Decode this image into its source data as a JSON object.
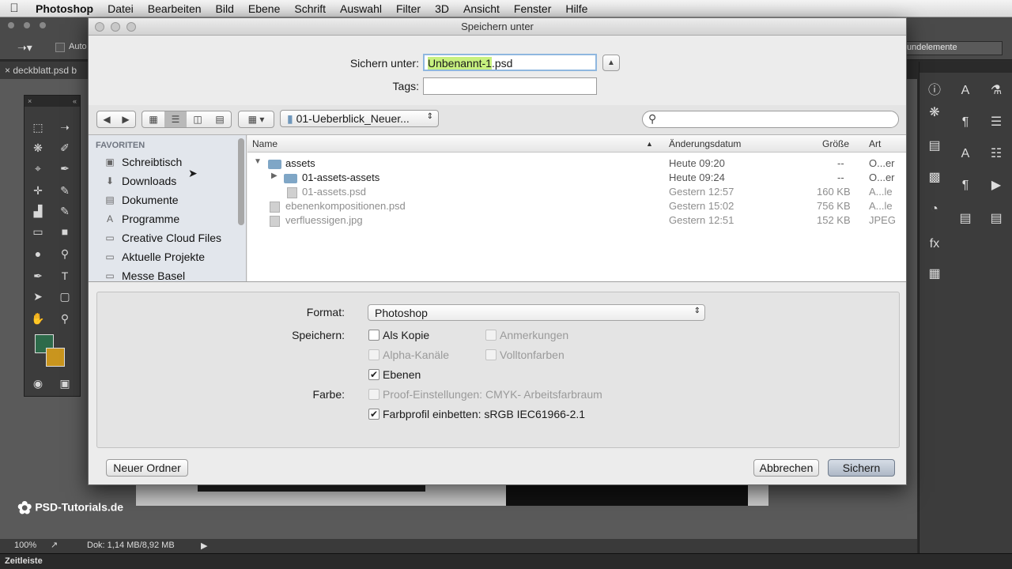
{
  "menubar": {
    "app": "Photoshop",
    "items": [
      "Datei",
      "Bearbeiten",
      "Bild",
      "Ebene",
      "Schrift",
      "Auswahl",
      "Filter",
      "3D",
      "Ansicht",
      "Fenster",
      "Hilfe"
    ]
  },
  "ps": {
    "doc_tab": "deckblatt.psd b",
    "options_right": "undelemente",
    "auto_label": "Auto",
    "zoom": "100%",
    "doc_size": "Dok: 1,14 MB/8,92 MB",
    "timeline": "Zeitleiste",
    "watermark": "PSD-Tutorials.de",
    "fg_color": "#2d6a4a",
    "bg_color": "#c9951e"
  },
  "dialog": {
    "title": "Speichern unter",
    "save_as_label": "Sichern unter:",
    "filename_selected": "Unbenannt-1",
    "filename_ext": ".psd",
    "tags_label": "Tags:",
    "tags_value": "",
    "expand_icon": "chevron-up-icon",
    "current_folder": "01-Ueberblick_Neuer...",
    "search_placeholder": ""
  },
  "sidebar": {
    "heading": "FAVORITEN",
    "items": [
      {
        "label": "Schreibtisch",
        "icon": "desktop-icon"
      },
      {
        "label": "Downloads",
        "icon": "downloads-icon"
      },
      {
        "label": "Dokumente",
        "icon": "documents-icon"
      },
      {
        "label": "Programme",
        "icon": "applications-icon"
      },
      {
        "label": "Creative Cloud Files",
        "icon": "folder-icon"
      },
      {
        "label": "Aktuelle Projekte",
        "icon": "folder-icon"
      },
      {
        "label": "Messe Basel",
        "icon": "folder-icon"
      }
    ]
  },
  "files": {
    "columns": {
      "name": "Name",
      "date": "Änderungsdatum",
      "size": "Größe",
      "kind": "Art"
    },
    "rows": [
      {
        "name": "assets",
        "date": "Heute 09:20",
        "size": "--",
        "kind": "O...er"
      },
      {
        "name": "01-assets-assets",
        "date": "Heute 09:24",
        "size": "--",
        "kind": "O...er"
      },
      {
        "name": "01-assets.psd",
        "date": "Gestern 12:57",
        "size": "160 KB",
        "kind": "A...le"
      },
      {
        "name": "ebenenkompositionen.psd",
        "date": "Gestern 15:02",
        "size": "756 KB",
        "kind": "A...le"
      },
      {
        "name": "verfluessigen.jpg",
        "date": "Gestern 12:51",
        "size": "152 KB",
        "kind": "JPEG"
      }
    ]
  },
  "options": {
    "format_label": "Format:",
    "format_value": "Photoshop",
    "save_label": "Speichern:",
    "color_label": "Farbe:",
    "as_copy": "Als Kopie",
    "notes": "Anmerkungen",
    "alpha": "Alpha-Kanäle",
    "spot": "Volltonfarben",
    "layers": "Ebenen",
    "proof": "Proof-Einstellungen:  CMYK- Arbeitsfarbraum",
    "icc": "Farbprofil einbetten:  sRGB IEC61966-2.1"
  },
  "buttons": {
    "new_folder": "Neuer Ordner",
    "cancel": "Abbrechen",
    "save": "Sichern"
  }
}
